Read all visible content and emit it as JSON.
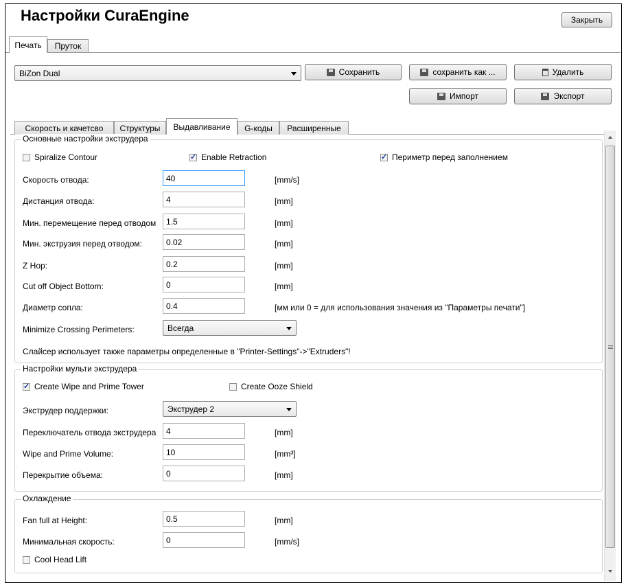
{
  "window": {
    "title": "Настройки CuraEngine",
    "close_label": "Закрыть"
  },
  "top_tabs": [
    "Печать",
    "Пруток"
  ],
  "profile": {
    "selected": "BiZon Dual",
    "save_label": "Сохранить",
    "save_as_label": "сохранить как ...",
    "delete_label": "Удалить",
    "import_label": "Импорт",
    "export_label": "Экспорт"
  },
  "sub_tabs": [
    "Скорость и качетсво",
    "Структуры",
    "Выдавливание",
    "G-коды",
    "Расширенные"
  ],
  "extruder_basic": {
    "legend": "Основные настройки экструдера",
    "spiralize_label": "Spiralize Contour",
    "spiralize_checked": false,
    "retraction_label": "Enable Retraction",
    "retraction_checked": true,
    "perimeter_label": "Периметр перед заполнением",
    "perimeter_checked": true,
    "fields": [
      {
        "label": "Скорость отвода:",
        "value": "40",
        "unit": "[mm/s]"
      },
      {
        "label": "Дистанция отвода:",
        "value": "4",
        "unit": "[mm]"
      },
      {
        "label": "Мин. перемещение перед отводом",
        "value": "1.5",
        "unit": "[mm]"
      },
      {
        "label": "Мин. экструзия перед отводом:",
        "value": "0.02",
        "unit": "[mm]"
      },
      {
        "label": "Z Hop:",
        "value": "0.2",
        "unit": "[mm]"
      },
      {
        "label": "Cut off Object Bottom:",
        "value": "0",
        "unit": "[mm]"
      },
      {
        "label": "Диаметр сопла:",
        "value": "0.4",
        "unit": "[мм или 0 = для использования значения из \"Параметры печати\"]"
      }
    ],
    "crossing_label": "Minimize Crossing Perimeters:",
    "crossing_value": "Всегда",
    "note": "Слайсер использует также параметры определенные в \"Printer-Settings\"->\"Extruders\"!"
  },
  "multi_extruder": {
    "legend": "Настройки мульти экструдера",
    "wipe_tower_label": "Create Wipe and Prime Tower",
    "wipe_tower_checked": true,
    "ooze_label": "Create Ooze Shield",
    "ooze_checked": false,
    "support_label": "Экструдер поддержки:",
    "support_value": "Экструдер 2",
    "fields": [
      {
        "label": "Переключатель отвода экструдера",
        "value": "4",
        "unit": "[mm]"
      },
      {
        "label": "Wipe and Prime Volume:",
        "value": "10",
        "unit": "[mm³]"
      },
      {
        "label": "Перекрытие объема:",
        "value": "0",
        "unit": "[mm]"
      }
    ]
  },
  "cooling": {
    "legend": "Охлаждение",
    "fields": [
      {
        "label": "Fan full at Height:",
        "value": "0.5",
        "unit": "[mm]"
      },
      {
        "label": "Минимальная скорость:",
        "value": "0",
        "unit": "[mm/s]"
      }
    ],
    "cool_head_label": "Cool Head Lift",
    "cool_head_checked": false
  }
}
